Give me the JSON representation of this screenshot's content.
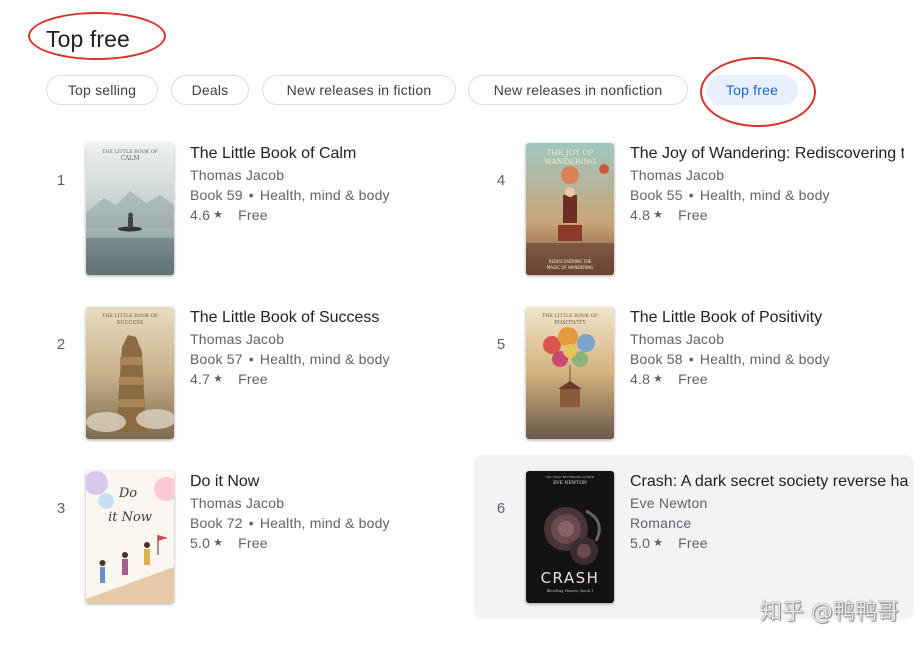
{
  "page": {
    "title": "Top free"
  },
  "chips": [
    {
      "label": "Top selling"
    },
    {
      "label": "Deals"
    },
    {
      "label": "New releases in fiction"
    },
    {
      "label": "New releases in nonfiction"
    },
    {
      "label": "Top free",
      "selected": true
    }
  ],
  "books": [
    {
      "rank": "1",
      "title": "The Little Book of Calm",
      "author": "Thomas Jacob",
      "series": "Book 59",
      "genre": "Health, mind & body",
      "rating": "4.6",
      "price": "Free",
      "cover_text": "THE LITTLE BOOK OF CALM"
    },
    {
      "rank": "2",
      "title": "The Little Book of Success",
      "author": "Thomas Jacob",
      "series": "Book 57",
      "genre": "Health, mind & body",
      "rating": "4.7",
      "price": "Free",
      "cover_text": "THE LITTLE BOOK OF SUCCESS"
    },
    {
      "rank": "3",
      "title": "Do it Now",
      "author": "Thomas Jacob",
      "series": "Book 72",
      "genre": "Health, mind & body",
      "rating": "5.0",
      "price": "Free",
      "cover_text": "Do it Now"
    },
    {
      "rank": "4",
      "title": "The Joy of Wandering: Rediscovering t",
      "author": "Thomas Jacob",
      "series": "Book 55",
      "genre": "Health, mind & body",
      "rating": "4.8",
      "price": "Free",
      "cover_text": "THE JOY OF WANDERING"
    },
    {
      "rank": "5",
      "title": "The Little Book of Positivity",
      "author": "Thomas Jacob",
      "series": "Book 58",
      "genre": "Health, mind & body",
      "rating": "4.8",
      "price": "Free",
      "cover_text": "THE LITTLE BOOK OF POSITIVITY"
    },
    {
      "rank": "6",
      "title": "Crash: A dark secret society reverse ha",
      "author": "Eve Newton",
      "genre": "Romance",
      "rating": "5.0",
      "price": "Free",
      "cover_text": "CRASH",
      "cover_author": "EVE NEWTON",
      "cover_subtitle": "Bleeding Hearts, Book 1"
    }
  ],
  "icons": {
    "star": "star-icon"
  },
  "colors": {
    "accent": "#1967d2",
    "chip_active_bg": "#e8f0fe",
    "annotation": "#d7322a",
    "highlight_bg": "#f1f3f4"
  },
  "watermark": "知乎 @鸭鸭哥"
}
